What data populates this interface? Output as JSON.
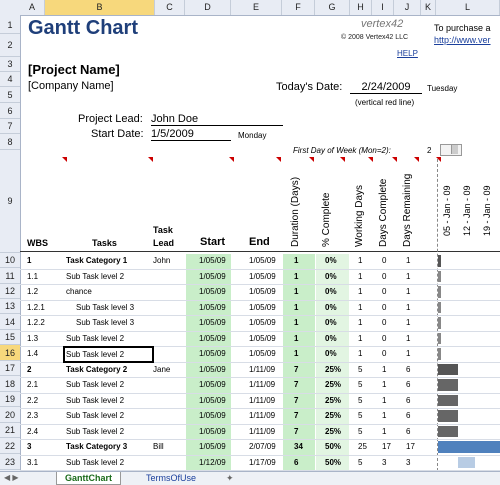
{
  "columns": [
    "A",
    "B",
    "C",
    "D",
    "E",
    "F",
    "G",
    "H",
    "I",
    "J",
    "K",
    "L"
  ],
  "selected_column": "B",
  "rows": [
    "1",
    "2",
    "3",
    "4",
    "5",
    "6",
    "7",
    "8",
    "9",
    "10",
    "11",
    "12",
    "13",
    "14",
    "15",
    "16",
    "17",
    "18",
    "19",
    "20",
    "21",
    "22",
    "23"
  ],
  "selected_row": "16",
  "title": "Gantt Chart",
  "logo": {
    "text": "vertex42",
    "copyright": "© 2008 Vertex42 LLC",
    "help": "HELP",
    "side_text": "To purchase a",
    "side_link": "http://www.ver"
  },
  "project_name": "[Project Name]",
  "company_name": "[Company Name]",
  "today_label": "Today's Date:",
  "today_value": "2/24/2009",
  "today_day": "Tuesday",
  "today_note": "(vertical red line)",
  "lead_label": "Project Lead:",
  "lead_value": "John Doe",
  "start_label": "Start Date:",
  "start_value": "1/5/2009",
  "start_day": "Monday",
  "first_day_label": "First Day of Week (Mon=2):",
  "first_day_value": "2",
  "headers": {
    "wbs": "WBS",
    "tasks": "Tasks",
    "task_lead_1": "Task",
    "task_lead_2": "Lead",
    "start": "Start",
    "end": "End",
    "duration": "Duration (Days)",
    "complete": "% Complete",
    "working_days": "Working Days",
    "days_complete": "Days Complete",
    "days_remaining": "Days Remaining",
    "week1": "05 - Jan - 09",
    "week2": "12 - Jan - 09",
    "week3": "19 - Jan - 09"
  },
  "tasks": [
    {
      "wbs": "1",
      "task": "Task Category 1",
      "lead": "John",
      "start": "1/05/09",
      "end": "1/05/09",
      "dur": "1",
      "pct": "0%",
      "wd": "1",
      "dc": "0",
      "dr": "1",
      "bold": true,
      "indent": 0
    },
    {
      "wbs": "1.1",
      "task": "Sub Task level 2",
      "lead": "",
      "start": "1/05/09",
      "end": "1/05/09",
      "dur": "1",
      "pct": "0%",
      "wd": "1",
      "dc": "0",
      "dr": "1",
      "bold": false,
      "indent": 1
    },
    {
      "wbs": "1.2",
      "task": "chance",
      "lead": "",
      "start": "1/05/09",
      "end": "1/05/09",
      "dur": "1",
      "pct": "0%",
      "wd": "1",
      "dc": "0",
      "dr": "1",
      "bold": false,
      "indent": 1
    },
    {
      "wbs": "1.2.1",
      "task": "Sub Task level 3",
      "lead": "",
      "start": "1/05/09",
      "end": "1/05/09",
      "dur": "1",
      "pct": "0%",
      "wd": "1",
      "dc": "0",
      "dr": "1",
      "bold": false,
      "indent": 2
    },
    {
      "wbs": "1.2.2",
      "task": "Sub Task level 3",
      "lead": "",
      "start": "1/05/09",
      "end": "1/05/09",
      "dur": "1",
      "pct": "0%",
      "wd": "1",
      "dc": "0",
      "dr": "1",
      "bold": false,
      "indent": 2
    },
    {
      "wbs": "1.3",
      "task": "Sub Task level 2",
      "lead": "",
      "start": "1/05/09",
      "end": "1/05/09",
      "dur": "1",
      "pct": "0%",
      "wd": "1",
      "dc": "0",
      "dr": "1",
      "bold": false,
      "indent": 1
    },
    {
      "wbs": "1.4",
      "task": "Sub Task level 2",
      "lead": "",
      "start": "1/05/09",
      "end": "1/05/09",
      "dur": "1",
      "pct": "0%",
      "wd": "1",
      "dc": "0",
      "dr": "1",
      "bold": false,
      "indent": 1
    },
    {
      "wbs": "2",
      "task": "Task Category 2",
      "lead": "Jane",
      "start": "1/05/09",
      "end": "1/11/09",
      "dur": "7",
      "pct": "25%",
      "wd": "5",
      "dc": "1",
      "dr": "6",
      "bold": true,
      "indent": 0
    },
    {
      "wbs": "2.1",
      "task": "Sub Task level 2",
      "lead": "",
      "start": "1/05/09",
      "end": "1/11/09",
      "dur": "7",
      "pct": "25%",
      "wd": "5",
      "dc": "1",
      "dr": "6",
      "bold": false,
      "indent": 1
    },
    {
      "wbs": "2.2",
      "task": "Sub Task level 2",
      "lead": "",
      "start": "1/05/09",
      "end": "1/11/09",
      "dur": "7",
      "pct": "25%",
      "wd": "5",
      "dc": "1",
      "dr": "6",
      "bold": false,
      "indent": 1
    },
    {
      "wbs": "2.3",
      "task": "Sub Task level 2",
      "lead": "",
      "start": "1/05/09",
      "end": "1/11/09",
      "dur": "7",
      "pct": "25%",
      "wd": "5",
      "dc": "1",
      "dr": "6",
      "bold": false,
      "indent": 1
    },
    {
      "wbs": "2.4",
      "task": "Sub Task level 2",
      "lead": "",
      "start": "1/05/09",
      "end": "1/11/09",
      "dur": "7",
      "pct": "25%",
      "wd": "5",
      "dc": "1",
      "dr": "6",
      "bold": false,
      "indent": 1
    },
    {
      "wbs": "3",
      "task": "Task Category 3",
      "lead": "Bill",
      "start": "1/05/09",
      "end": "2/07/09",
      "dur": "34",
      "pct": "50%",
      "wd": "25",
      "dc": "17",
      "dr": "17",
      "bold": true,
      "indent": 0
    },
    {
      "wbs": "3.1",
      "task": "Sub Task level 2",
      "lead": "",
      "start": "1/12/09",
      "end": "1/17/09",
      "dur": "6",
      "pct": "50%",
      "wd": "5",
      "dc": "3",
      "dr": "3",
      "bold": false,
      "indent": 1
    }
  ],
  "tabs": {
    "active": "GanttChart",
    "other": "TermsOfUse"
  },
  "colors": {
    "green": "#c9eec9",
    "gantt_dark": "#555555",
    "gantt_blue": "#4f81bd",
    "gantt_light_blue": "#b8cce4"
  }
}
